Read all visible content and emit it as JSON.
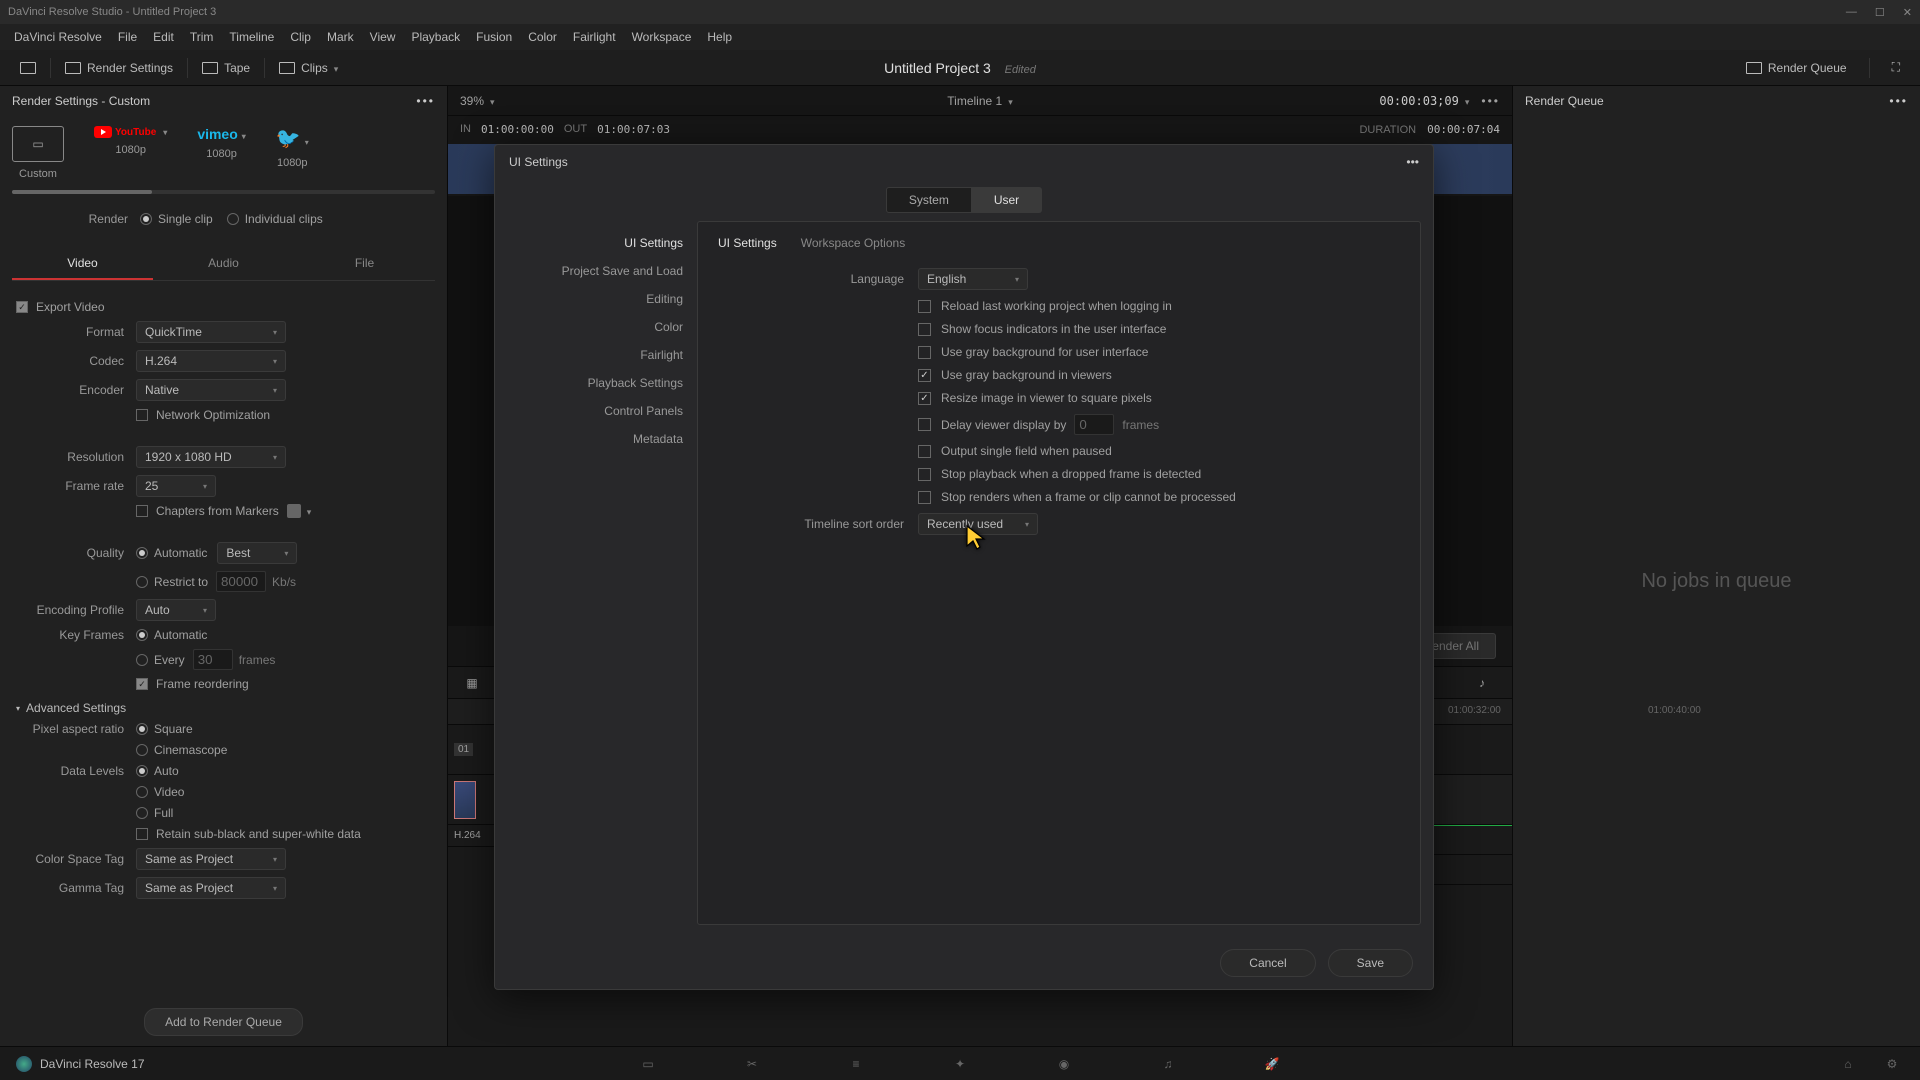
{
  "titlebar": {
    "text": "DaVinci Resolve Studio - Untitled Project 3"
  },
  "menubar": [
    "DaVinci Resolve",
    "File",
    "Edit",
    "Trim",
    "Timeline",
    "Clip",
    "Mark",
    "View",
    "Playback",
    "Fusion",
    "Color",
    "Fairlight",
    "Workspace",
    "Help"
  ],
  "toolbar": {
    "render_settings": "Render Settings",
    "tape": "Tape",
    "clips": "Clips",
    "project_title": "Untitled Project 3",
    "edited": "Edited",
    "render_queue": "Render Queue"
  },
  "left_panel": {
    "title": "Render Settings - Custom",
    "presets": [
      {
        "key": "custom",
        "label": "Custom"
      },
      {
        "key": "youtube",
        "label": "1080p"
      },
      {
        "key": "vimeo",
        "label": "1080p"
      },
      {
        "key": "twitter",
        "label": "1080p"
      }
    ],
    "render_label": "Render",
    "single_clip": "Single clip",
    "individual_clips": "Individual clips",
    "tabs": [
      "Video",
      "Audio",
      "File"
    ],
    "export_video": "Export Video",
    "format_lbl": "Format",
    "format_val": "QuickTime",
    "codec_lbl": "Codec",
    "codec_val": "H.264",
    "encoder_lbl": "Encoder",
    "encoder_val": "Native",
    "net_opt": "Network Optimization",
    "res_lbl": "Resolution",
    "res_val": "1920 x 1080 HD",
    "fr_lbl": "Frame rate",
    "fr_val": "25",
    "chapters": "Chapters from Markers",
    "quality_lbl": "Quality",
    "quality_auto": "Automatic",
    "quality_best": "Best",
    "restrict": "Restrict to",
    "restrict_val": "80000",
    "kbps": "Kb/s",
    "enc_profile_lbl": "Encoding Profile",
    "enc_profile_val": "Auto",
    "keyframes_lbl": "Key Frames",
    "keyframes_auto": "Automatic",
    "every": "Every",
    "every_val": "30",
    "frames": "frames",
    "frame_reorder": "Frame reordering",
    "advanced": "Advanced Settings",
    "par_lbl": "Pixel aspect ratio",
    "par_square": "Square",
    "par_cine": "Cinemascope",
    "dl_lbl": "Data Levels",
    "dl_auto": "Auto",
    "dl_video": "Video",
    "dl_full": "Full",
    "retain": "Retain sub-black and super-white data",
    "cst_lbl": "Color Space Tag",
    "cst_val": "Same as Project",
    "gt_lbl": "Gamma Tag",
    "gt_val": "Same as Project",
    "add_btn": "Add to Render Queue"
  },
  "viewer": {
    "zoom": "39%",
    "timeline_name": "Timeline 1",
    "timecode": "00:00:03;09",
    "in_lbl": "IN",
    "in_val": "01:00:00:00",
    "out_lbl": "OUT",
    "out_val": "01:00:07:03",
    "dur_lbl": "DURATION",
    "dur_val": "00:00:07:04",
    "clip_num": "01",
    "clip_name": "H.264",
    "render_all": "Render All",
    "ruler_marks": [
      "01:00:32:00",
      "01:00:40:00"
    ]
  },
  "right_panel": {
    "title": "Render Queue",
    "empty": "No jobs in queue"
  },
  "pagebar": {
    "brand": "DaVinci Resolve 17"
  },
  "modal": {
    "title": "UI Settings",
    "main_tabs": [
      "System",
      "User"
    ],
    "sidebar": [
      "UI Settings",
      "Project Save and Load",
      "Editing",
      "Color",
      "Fairlight",
      "Playback Settings",
      "Control Panels",
      "Metadata"
    ],
    "subtabs": [
      "UI Settings",
      "Workspace Options"
    ],
    "lang_lbl": "Language",
    "lang_val": "English",
    "opts": [
      {
        "label": "Reload last working project when logging in",
        "checked": false
      },
      {
        "label": "Show focus indicators in the user interface",
        "checked": false
      },
      {
        "label": "Use gray background for user interface",
        "checked": false
      },
      {
        "label": "Use gray background in viewers",
        "checked": true
      },
      {
        "label": "Resize image in viewer to square pixels",
        "checked": true
      }
    ],
    "delay_lbl": "Delay viewer display by",
    "delay_val": "0",
    "delay_unit": "frames",
    "opts2": [
      {
        "label": "Output single field when paused",
        "checked": false
      },
      {
        "label": "Stop playback when a dropped frame is detected",
        "checked": false
      },
      {
        "label": "Stop renders when a frame or clip cannot be processed",
        "checked": false
      }
    ],
    "sort_lbl": "Timeline sort order",
    "sort_val": "Recently used",
    "cancel": "Cancel",
    "save": "Save"
  }
}
